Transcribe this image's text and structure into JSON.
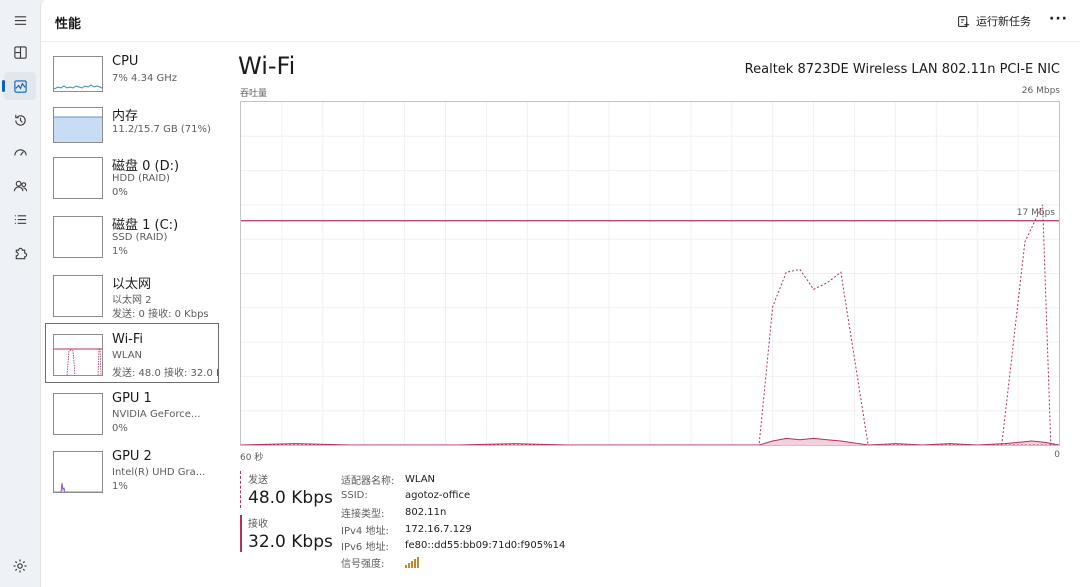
{
  "header": {
    "title": "性能",
    "run_task_label": "运行新任务",
    "more_label": "···"
  },
  "resources": [
    {
      "name": "CPU",
      "lines": [
        "7% 4.34 GHz"
      ]
    },
    {
      "name": "内存",
      "lines": [
        "11.2/15.7 GB (71%)"
      ]
    },
    {
      "name": "磁盘 0 (D:)",
      "lines": [
        "HDD (RAID)",
        "0%"
      ]
    },
    {
      "name": "磁盘 1 (C:)",
      "lines": [
        "SSD (RAID)",
        "1%"
      ]
    },
    {
      "name": "以太网",
      "lines": [
        "以太网 2",
        "发送: 0 接收: 0 Kbps"
      ]
    },
    {
      "name": "Wi-Fi",
      "lines": [
        "WLAN",
        "发送: 48.0 接收: 32.0 K"
      ]
    },
    {
      "name": "GPU 1",
      "lines": [
        "NVIDIA GeForce...",
        "0%"
      ]
    },
    {
      "name": "GPU 2",
      "lines": [
        "Intel(R) UHD Gra...",
        "1%"
      ]
    }
  ],
  "selected_resource": "Wi-Fi",
  "detail": {
    "title": "Wi-Fi",
    "adapter": "Realtek 8723DE Wireless LAN 802.11n PCI-E NIC",
    "throughput_label": "吞吐量",
    "max_label": "26 Mbps",
    "limit_label": "17 Mbps",
    "time_label": "60 秒",
    "zero_label": "0"
  },
  "stats": {
    "send_label": "发送",
    "send_value": "48.0 Kbps",
    "recv_label": "接收",
    "recv_value": "32.0 Kbps"
  },
  "properties": [
    {
      "key": "适配器名称:",
      "value": "WLAN"
    },
    {
      "key": "SSID:",
      "value": "agotoz-office"
    },
    {
      "key": "连接类型:",
      "value": "802.11n"
    },
    {
      "key": "IPv4 地址:",
      "value": "172.16.7.129"
    },
    {
      "key": "IPv6 地址:",
      "value": "fe80::dd55:bb09:71d0:f905%14"
    },
    {
      "key": "信号强度:",
      "value": ""
    }
  ],
  "colors": {
    "accent": "#b5305f",
    "memory_fill": "#c7ddf6",
    "cpu_line": "#2f8fb7",
    "gpu_line": "#8a3fcf",
    "signal": "#c58a1f"
  },
  "chart_data": {
    "type": "line",
    "xlabel": "60 秒",
    "ylabel": "吞吐量",
    "ylim": [
      0,
      26
    ],
    "limit_mbps": 17,
    "x_seconds_ago": [
      60,
      56,
      52,
      48,
      44,
      40,
      36,
      32,
      28,
      24,
      22,
      21,
      20,
      19,
      18,
      17,
      16,
      14,
      12,
      10,
      8,
      6,
      4,
      3,
      2,
      1,
      0
    ],
    "series": [
      {
        "name": "发送",
        "values": [
          0,
          0,
          0,
          0,
          0,
          0,
          0,
          0,
          0,
          0,
          0,
          10.5,
          13.1,
          13.3,
          11.8,
          12.3,
          13.1,
          0,
          0,
          0,
          0,
          0,
          0,
          0,
          0,
          0,
          0
        ]
      },
      {
        "name": "接收",
        "values": [
          0,
          0.1,
          0,
          0,
          0,
          0.1,
          0,
          0,
          0,
          0,
          0,
          0.3,
          0.5,
          0.4,
          0.5,
          0.4,
          0.3,
          0,
          0.1,
          0,
          0.1,
          0,
          0.1,
          0.2,
          0.3,
          0.2,
          0
        ]
      }
    ],
    "spike_right": {
      "x_seconds_ago": [
        4.2,
        2.5,
        1.2,
        0.6
      ],
      "values": [
        0,
        15.4,
        18.2,
        0
      ]
    }
  }
}
